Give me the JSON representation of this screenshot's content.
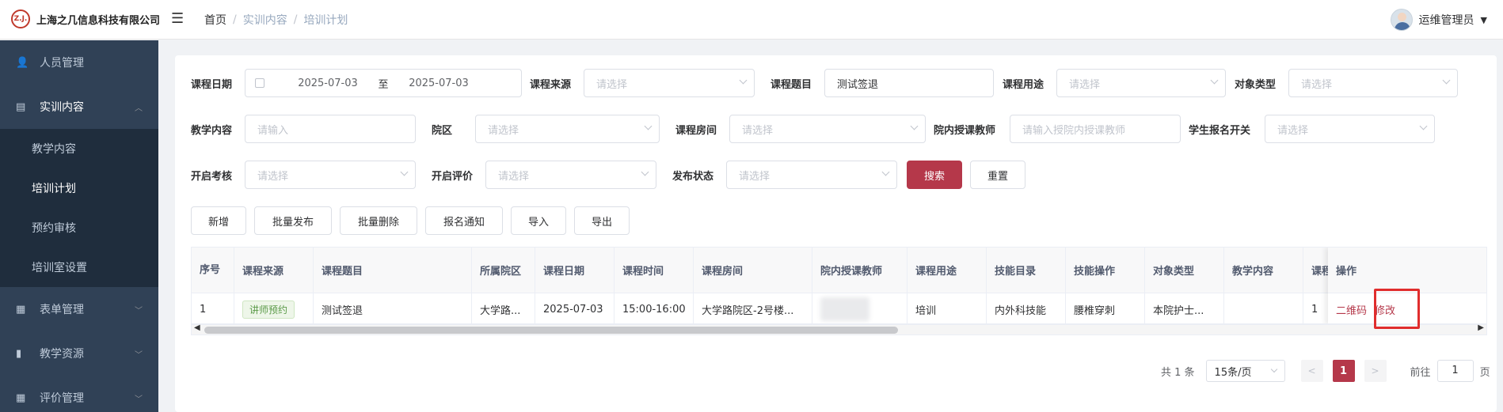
{
  "header": {
    "logo_mark": "Z.J.",
    "company": "上海之几信息科技有限公司",
    "breadcrumb": [
      "首页",
      "实训内容",
      "培训计划"
    ],
    "breadcrumb_sep": "/",
    "user_name": "运维管理员"
  },
  "sidebar": {
    "items": [
      {
        "label": "人员管理",
        "icon": "user-icon"
      },
      {
        "label": "实训内容",
        "icon": "book-icon",
        "open": true
      },
      {
        "label": "表单管理",
        "icon": "form-icon"
      },
      {
        "label": "教学资源",
        "icon": "resource-icon"
      },
      {
        "label": "评价管理",
        "icon": "evaluation-icon"
      }
    ],
    "subitems": [
      "教学内容",
      "培训计划",
      "预约审核",
      "培训室设置"
    ]
  },
  "filters": {
    "course_date_label": "课程日期",
    "date_start": "2025-07-03",
    "date_sep": "至",
    "date_end": "2025-07-03",
    "course_source_label": "课程来源",
    "course_source_ph": "请选择",
    "course_title_label": "课程题目",
    "course_title_value": "测试签退",
    "course_use_label": "课程用途",
    "course_use_ph": "请选择",
    "target_type_label": "对象类型",
    "target_type_ph": "请选择",
    "teaching_content_label": "教学内容",
    "teaching_content_ph": "请输入",
    "campus_label": "院区",
    "campus_ph": "请选择",
    "room_label": "课程房间",
    "room_ph": "请选择",
    "teacher_label": "院内授课教师",
    "teacher_ph": "请输入授院内授课教师",
    "enroll_switch_label": "学生报名开关",
    "enroll_switch_ph": "请选择",
    "exam_label": "开启考核",
    "exam_ph": "请选择",
    "eval_label": "开启评价",
    "eval_ph": "请选择",
    "publish_label": "发布状态",
    "publish_ph": "请选择",
    "search_btn": "搜索",
    "reset_btn": "重置"
  },
  "toolbar": {
    "add": "新增",
    "batch_publish": "批量发布",
    "batch_delete": "批量删除",
    "enroll_notice": "报名通知",
    "import": "导入",
    "export": "导出"
  },
  "table": {
    "headers": [
      "序号",
      "课程来源",
      "课程题目",
      "所属院区",
      "课程日期",
      "课程时间",
      "课程房间",
      "院内授课教师",
      "课程用途",
      "技能目录",
      "技能操作",
      "对象类型",
      "教学内容",
      "课程",
      "操作"
    ],
    "row": {
      "index": "1",
      "source": "讲师预约",
      "title": "测试签退",
      "campus": "大学路...",
      "date": "2025-07-03",
      "time": "15:00-16:00",
      "room": "大学路院区-2号楼...",
      "use": "培训",
      "skill_catalog": "内外科技能",
      "skill_operation": "腰椎穿刺",
      "target_type": "本院护士...",
      "teaching_content": "",
      "course_extra": "1",
      "op_qrcode": "二维码",
      "op_edit": "修改"
    }
  },
  "pagination": {
    "total": "共 1 条",
    "page_size": "15条/页",
    "current": "1",
    "goto_label": "前往",
    "goto_value": "1",
    "page_suffix": "页"
  }
}
